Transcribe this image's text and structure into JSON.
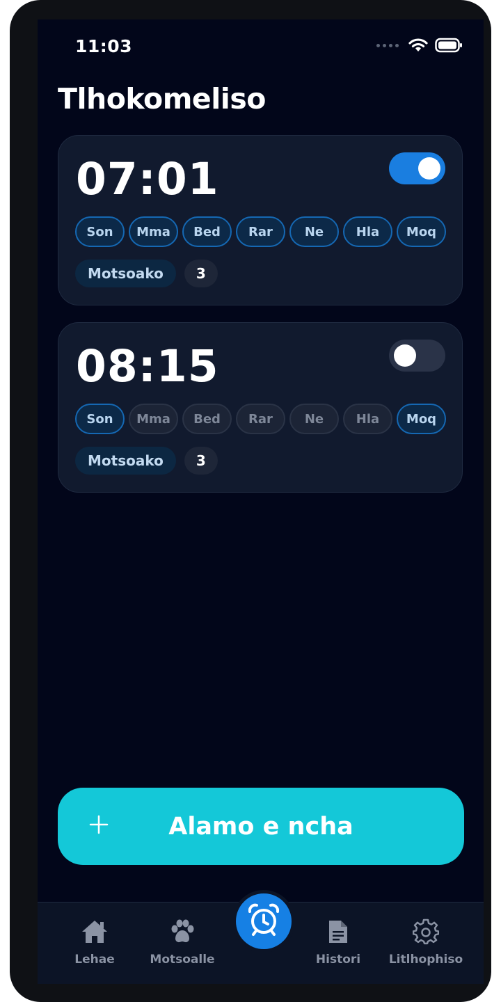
{
  "status_bar": {
    "time": "11:03"
  },
  "page_title": "Tlhokomeliso",
  "alarms": [
    {
      "time": "07:01",
      "enabled": true,
      "days": [
        {
          "label": "Son",
          "active": true
        },
        {
          "label": "Mma",
          "active": true
        },
        {
          "label": "Bed",
          "active": true
        },
        {
          "label": "Rar",
          "active": true
        },
        {
          "label": "Ne",
          "active": true
        },
        {
          "label": "Hla",
          "active": true
        },
        {
          "label": "Moq",
          "active": true
        }
      ],
      "snooze_label": "Motsoako",
      "count": "3"
    },
    {
      "time": "08:15",
      "enabled": false,
      "days": [
        {
          "label": "Son",
          "active": true
        },
        {
          "label": "Mma",
          "active": false
        },
        {
          "label": "Bed",
          "active": false
        },
        {
          "label": "Rar",
          "active": false
        },
        {
          "label": "Ne",
          "active": false
        },
        {
          "label": "Hla",
          "active": false
        },
        {
          "label": "Moq",
          "active": true
        }
      ],
      "snooze_label": "Motsoako",
      "count": "3"
    }
  ],
  "new_alarm_button": {
    "label": "Alamo e ncha",
    "icon": "plus-icon"
  },
  "bottom_nav": {
    "items": [
      {
        "label": "Lehae",
        "icon": "home-icon"
      },
      {
        "label": "Motsoalle",
        "icon": "paw-icon"
      },
      {
        "label": "",
        "icon": "alarm-clock-icon",
        "active": true
      },
      {
        "label": "Histori",
        "icon": "document-icon"
      },
      {
        "label": "Litlhophiso",
        "icon": "gear-icon"
      }
    ]
  },
  "colors": {
    "background": "#02061a",
    "card": "#111a2e",
    "accent_blue": "#1a7ee0",
    "button_teal": "#14c8d8",
    "nav_text": "#8b93a4"
  }
}
